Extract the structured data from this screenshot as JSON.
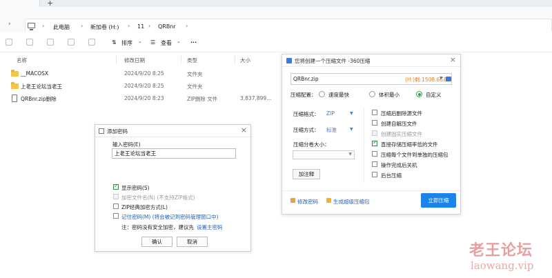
{
  "explorer": {
    "new_tab_glyph": "+",
    "breadcrumbs": [
      "此电脑",
      "新加卷 (H:)",
      "11",
      "QRBnr"
    ],
    "toolbar": {
      "sort_label": "排序",
      "view_label": "查看",
      "more_glyph": "···"
    },
    "columns": {
      "name": "名称",
      "date": "修改日期",
      "type": "类型",
      "size": "大小"
    },
    "files": [
      {
        "name": "__MACOSX",
        "date": "2024/9/20 8:25",
        "type": "文件夹",
        "size": "",
        "icon": "folder-icon"
      },
      {
        "name": "上老王论坛当老王",
        "date": "2024/9/20 8:25",
        "type": "文件夹",
        "size": "",
        "icon": "folder-icon"
      },
      {
        "name": "QRBnr.zip删除",
        "date": "2024/9/20 8:23",
        "type": "ZIP删除 文件",
        "size": "3,837,899...",
        "icon": "file-icon"
      }
    ]
  },
  "password_dialog": {
    "title": "添加密码",
    "input_label": "输入密码(E)",
    "password_value": "上老王论坛当老王",
    "options": {
      "show_password": "显示密码(S)",
      "encrypt_names": "加密文件名(N) (不支持ZIP格式)",
      "zip_classic": "ZIP经典加密方式(L)",
      "remember_password": "记住密码(M) (将会被记到密码管理窗口中)"
    },
    "note_prefix": "注：密码没有安全加密，建议先",
    "note_link": "设置主密码",
    "ok_label": "确认",
    "cancel_label": "取消"
  },
  "zip_dialog": {
    "title": "您将创建一个压缩文件 -360压缩",
    "path_value": "QRBnr.zip",
    "free_space": "(H:)剩:1508.6GB",
    "config_label": "压缩配置：",
    "radio_options": [
      "速度最快",
      "体积最小",
      "自定义"
    ],
    "format_label": "压缩格式：",
    "format_value": "ZIP",
    "method_label": "压缩方式：",
    "method_value": "标准",
    "split_label": "压缩分卷大小：",
    "comment_button": "加注释",
    "check_options": [
      "压缩后删除源文件",
      "创建自解压文件",
      "创建固实压缩文件",
      "直接存储压缩率低的文件",
      "压缩每个文件到单独的压缩包",
      "操作完成后关机",
      "后台压缩"
    ],
    "change_password_link": "修改密码",
    "super_zip_link": "生成超级压缩包",
    "start_button": "立即压缩"
  },
  "watermark": {
    "text_cn": "老王论坛",
    "text_en": "laowang.vip"
  },
  "colors": {
    "accent": "#1a84e8",
    "check_green": "#2a8a3e",
    "free_space_orange": "#e8831b",
    "folder_yellow": "#f2c64a"
  }
}
